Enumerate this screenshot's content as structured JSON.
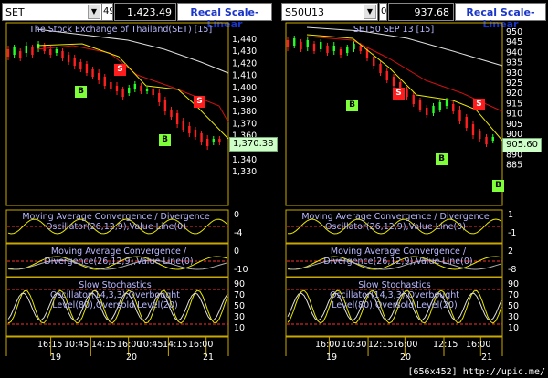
{
  "left": {
    "symbol": "SET",
    "prev_price_fragment": "49",
    "price": "1,423.49",
    "recal_label": "Recal Scale-Linear",
    "chart_title": "The Stock Exchange of Thailand(SET) [15]",
    "price_axis": [
      "1,440",
      "1,430",
      "1,420",
      "1,410",
      "1,400",
      "1,390",
      "1,380",
      "1,370",
      "1,360",
      "1,350",
      "1,340",
      "1,330"
    ],
    "last_price": "1,370.38",
    "macd1_label": "Moving Average Convergence / Divergence Oscillator(26,12,9),Value Line(0)",
    "macd1_axis": [
      "0",
      "-4"
    ],
    "macd2_label": "Moving Average Convergence / Divergence(26,12,9),Value Line(0)",
    "macd2_axis": [
      "0",
      "-10"
    ],
    "stoch_label": "Slow Stochastics Oscillator(14,3,3),Overbought Level(80),Oversold Level(20)",
    "stoch_axis": [
      "90",
      "70",
      "50",
      "30",
      "10"
    ],
    "time_labels": [
      "16:15",
      "10:45",
      "14:15",
      "16:00",
      "10:45",
      "14:15",
      "16:00"
    ],
    "date_labels": [
      "19",
      "20",
      "21"
    ],
    "signals": [
      "B",
      "S",
      "S",
      "B",
      "S"
    ]
  },
  "right": {
    "symbol": "S50U13",
    "prev_price_fragment": "0",
    "price": "937.68",
    "recal_label": "Recal Scale-Linear",
    "chart_title": "SET50 SEP 13  [15]",
    "price_axis": [
      "950",
      "945",
      "940",
      "935",
      "930",
      "925",
      "920",
      "915",
      "910",
      "905",
      "900",
      "895",
      "890",
      "885"
    ],
    "last_price": "905.60",
    "macd1_label": "Moving Average Convergence / Divergence Oscillator(26,12,9),Value Line(0)",
    "macd1_axis": [
      "1",
      "-1"
    ],
    "macd2_label": "Moving Average Convergence / Divergence(26,12,9),Value Line(0)",
    "macd2_axis": [
      "2",
      "-8"
    ],
    "stoch_label": "Slow Stochastics Oscillator(14,3,3),Overbought Level(80),Oversold Level(20)",
    "stoch_axis": [
      "90",
      "70",
      "50",
      "30",
      "10"
    ],
    "time_labels": [
      "16:00",
      "10:30",
      "12:15",
      "16:00",
      "12:15",
      "16:00"
    ],
    "date_labels": [
      "19",
      "20",
      "21"
    ],
    "signals": [
      "B",
      "S",
      "B",
      "S",
      "B",
      "B"
    ]
  },
  "colors": {
    "panel_border": "#c8a800",
    "dashed": "#ff3030",
    "candle_up": "#28ff28",
    "candle_down": "#ff2020",
    "ma_yellow": "#e8e800",
    "ma_red": "#d01010",
    "ma_white": "#e0e0e0",
    "macd_line": "#b0b0b0"
  },
  "watermark": "[656x452] http://upic.me/"
}
